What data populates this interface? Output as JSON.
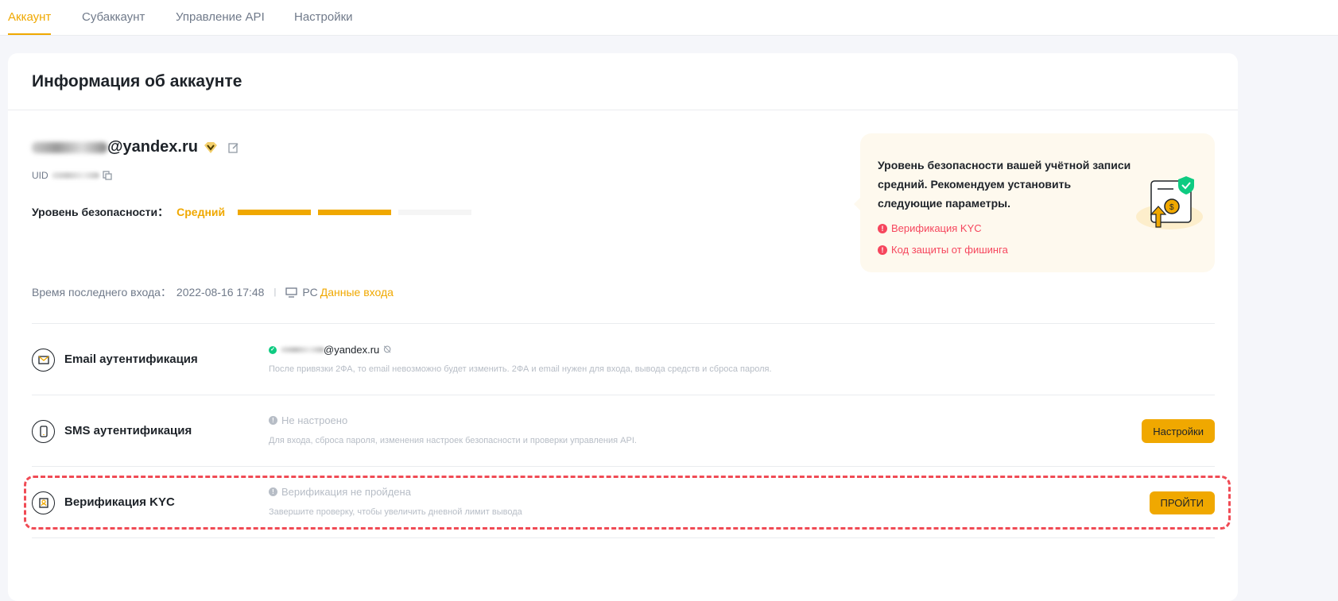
{
  "tabs": [
    "Аккаунт",
    "Субаккаунт",
    "Управление API",
    "Настройки"
  ],
  "page_title": "Информация об аккаунте",
  "account": {
    "email_suffix": "@yandex.ru",
    "uid_label": "UID",
    "security_label": "Уровень безопасности：",
    "security_level": "Средний",
    "security_progress": {
      "filled": 2,
      "total": 3
    }
  },
  "alert": {
    "message": "Уровень безопасности вашей учётной записи средний. Рекомендуем установить следующие параметры.",
    "items": [
      "Верификация KYC",
      "Код защиты от фишинга"
    ]
  },
  "last_login": {
    "label": "Время последнего входа：",
    "time": "2022-08-16 17:48",
    "separator": "|",
    "device": "PC",
    "link": "Данные входа"
  },
  "rows": [
    {
      "name": "Email аутентификация",
      "status": "@yandex.ru",
      "desc": "После привязки 2ФА, то email невозможно будет изменить. 2ФА и email нужен для входа, вывода средств и сброса пароля."
    },
    {
      "name": "SMS аутентификация",
      "status": "Не настроено",
      "desc": "Для входа, сброса пароля, изменения настроек безопасности и проверки управления API.",
      "button": "Настройки"
    },
    {
      "name": "Верификация KYC",
      "status": "Верификация не пройдена",
      "desc": "Завершите проверку, чтобы увеличить дневной лимит вывода",
      "button": "ПРОЙТИ"
    }
  ],
  "colors": {
    "accent": "#f0a800",
    "danger": "#f6465d",
    "success": "#0ecb81"
  }
}
